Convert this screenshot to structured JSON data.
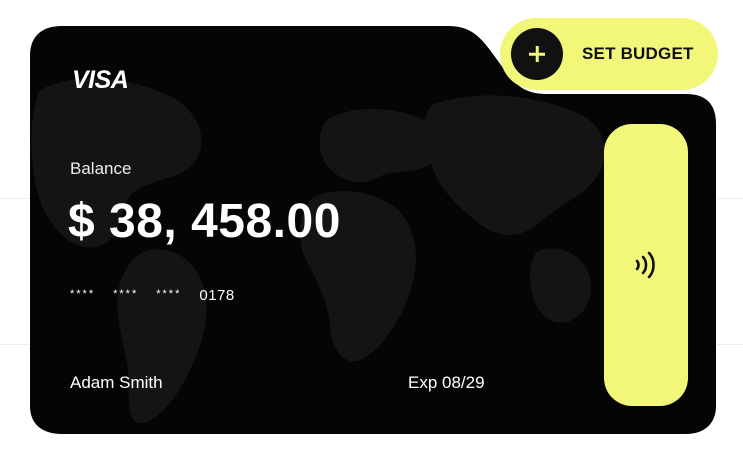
{
  "card": {
    "brand": "VISA",
    "balance_label": "Balance",
    "balance_value": "$ 38, 458.00",
    "number_masked_groups": [
      "****",
      "****",
      "****"
    ],
    "number_last4": "0178",
    "holder_name": "Adam Smith",
    "expiry": "Exp 08/29",
    "background_color": "#050505",
    "accent_color": "#F2F77A"
  },
  "actions": {
    "set_budget_label": "SET BUDGET",
    "set_budget_icon": "plus-icon",
    "contactless_icon": "contactless-icon"
  }
}
